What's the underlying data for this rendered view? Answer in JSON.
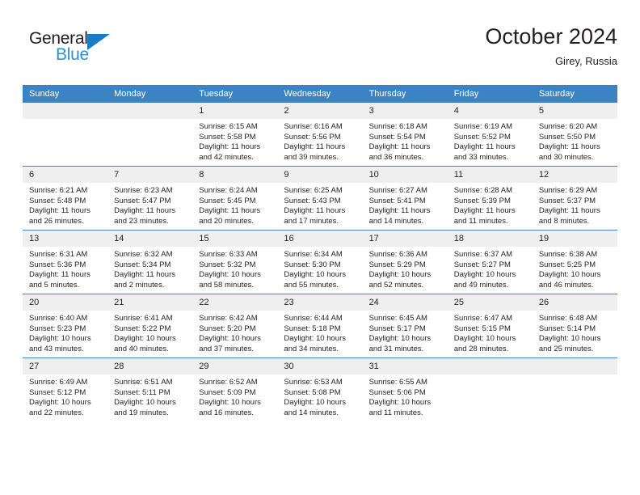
{
  "brand": {
    "name_top": "General",
    "name_bottom": "Blue",
    "triangle_color": "#1b7bc4",
    "blue_text_color": "#2f8fd6"
  },
  "header": {
    "title": "October 2024",
    "subtitle": "Girey, Russia"
  },
  "theme": {
    "header_bg": "#3c83c4",
    "header_text": "#ffffff",
    "daynum_bg": "#efefef",
    "row_divider": "#3c83c4",
    "body_text": "#231f20"
  },
  "weekdays": [
    "Sunday",
    "Monday",
    "Tuesday",
    "Wednesday",
    "Thursday",
    "Friday",
    "Saturday"
  ],
  "labels": {
    "sunrise_prefix": "Sunrise:",
    "sunset_prefix": "Sunset:",
    "daylight_prefix": "Daylight:"
  },
  "weeks": [
    [
      {
        "day": "",
        "empty": true,
        "line1": "",
        "line2": "",
        "line3": "",
        "line4": ""
      },
      {
        "day": "",
        "empty": true,
        "line1": "",
        "line2": "",
        "line3": "",
        "line4": ""
      },
      {
        "day": "1",
        "empty": false,
        "line1": "Sunrise: 6:15 AM",
        "line2": "Sunset: 5:58 PM",
        "line3": "Daylight: 11 hours",
        "line4": "and 42 minutes."
      },
      {
        "day": "2",
        "empty": false,
        "line1": "Sunrise: 6:16 AM",
        "line2": "Sunset: 5:56 PM",
        "line3": "Daylight: 11 hours",
        "line4": "and 39 minutes."
      },
      {
        "day": "3",
        "empty": false,
        "line1": "Sunrise: 6:18 AM",
        "line2": "Sunset: 5:54 PM",
        "line3": "Daylight: 11 hours",
        "line4": "and 36 minutes."
      },
      {
        "day": "4",
        "empty": false,
        "line1": "Sunrise: 6:19 AM",
        "line2": "Sunset: 5:52 PM",
        "line3": "Daylight: 11 hours",
        "line4": "and 33 minutes."
      },
      {
        "day": "5",
        "empty": false,
        "line1": "Sunrise: 6:20 AM",
        "line2": "Sunset: 5:50 PM",
        "line3": "Daylight: 11 hours",
        "line4": "and 30 minutes."
      }
    ],
    [
      {
        "day": "6",
        "empty": false,
        "line1": "Sunrise: 6:21 AM",
        "line2": "Sunset: 5:48 PM",
        "line3": "Daylight: 11 hours",
        "line4": "and 26 minutes."
      },
      {
        "day": "7",
        "empty": false,
        "line1": "Sunrise: 6:23 AM",
        "line2": "Sunset: 5:47 PM",
        "line3": "Daylight: 11 hours",
        "line4": "and 23 minutes."
      },
      {
        "day": "8",
        "empty": false,
        "line1": "Sunrise: 6:24 AM",
        "line2": "Sunset: 5:45 PM",
        "line3": "Daylight: 11 hours",
        "line4": "and 20 minutes."
      },
      {
        "day": "9",
        "empty": false,
        "line1": "Sunrise: 6:25 AM",
        "line2": "Sunset: 5:43 PM",
        "line3": "Daylight: 11 hours",
        "line4": "and 17 minutes."
      },
      {
        "day": "10",
        "empty": false,
        "line1": "Sunrise: 6:27 AM",
        "line2": "Sunset: 5:41 PM",
        "line3": "Daylight: 11 hours",
        "line4": "and 14 minutes."
      },
      {
        "day": "11",
        "empty": false,
        "line1": "Sunrise: 6:28 AM",
        "line2": "Sunset: 5:39 PM",
        "line3": "Daylight: 11 hours",
        "line4": "and 11 minutes."
      },
      {
        "day": "12",
        "empty": false,
        "line1": "Sunrise: 6:29 AM",
        "line2": "Sunset: 5:37 PM",
        "line3": "Daylight: 11 hours",
        "line4": "and 8 minutes."
      }
    ],
    [
      {
        "day": "13",
        "empty": false,
        "line1": "Sunrise: 6:31 AM",
        "line2": "Sunset: 5:36 PM",
        "line3": "Daylight: 11 hours",
        "line4": "and 5 minutes."
      },
      {
        "day": "14",
        "empty": false,
        "line1": "Sunrise: 6:32 AM",
        "line2": "Sunset: 5:34 PM",
        "line3": "Daylight: 11 hours",
        "line4": "and 2 minutes."
      },
      {
        "day": "15",
        "empty": false,
        "line1": "Sunrise: 6:33 AM",
        "line2": "Sunset: 5:32 PM",
        "line3": "Daylight: 10 hours",
        "line4": "and 58 minutes."
      },
      {
        "day": "16",
        "empty": false,
        "line1": "Sunrise: 6:34 AM",
        "line2": "Sunset: 5:30 PM",
        "line3": "Daylight: 10 hours",
        "line4": "and 55 minutes."
      },
      {
        "day": "17",
        "empty": false,
        "line1": "Sunrise: 6:36 AM",
        "line2": "Sunset: 5:29 PM",
        "line3": "Daylight: 10 hours",
        "line4": "and 52 minutes."
      },
      {
        "day": "18",
        "empty": false,
        "line1": "Sunrise: 6:37 AM",
        "line2": "Sunset: 5:27 PM",
        "line3": "Daylight: 10 hours",
        "line4": "and 49 minutes."
      },
      {
        "day": "19",
        "empty": false,
        "line1": "Sunrise: 6:38 AM",
        "line2": "Sunset: 5:25 PM",
        "line3": "Daylight: 10 hours",
        "line4": "and 46 minutes."
      }
    ],
    [
      {
        "day": "20",
        "empty": false,
        "line1": "Sunrise: 6:40 AM",
        "line2": "Sunset: 5:23 PM",
        "line3": "Daylight: 10 hours",
        "line4": "and 43 minutes."
      },
      {
        "day": "21",
        "empty": false,
        "line1": "Sunrise: 6:41 AM",
        "line2": "Sunset: 5:22 PM",
        "line3": "Daylight: 10 hours",
        "line4": "and 40 minutes."
      },
      {
        "day": "22",
        "empty": false,
        "line1": "Sunrise: 6:42 AM",
        "line2": "Sunset: 5:20 PM",
        "line3": "Daylight: 10 hours",
        "line4": "and 37 minutes."
      },
      {
        "day": "23",
        "empty": false,
        "line1": "Sunrise: 6:44 AM",
        "line2": "Sunset: 5:18 PM",
        "line3": "Daylight: 10 hours",
        "line4": "and 34 minutes."
      },
      {
        "day": "24",
        "empty": false,
        "line1": "Sunrise: 6:45 AM",
        "line2": "Sunset: 5:17 PM",
        "line3": "Daylight: 10 hours",
        "line4": "and 31 minutes."
      },
      {
        "day": "25",
        "empty": false,
        "line1": "Sunrise: 6:47 AM",
        "line2": "Sunset: 5:15 PM",
        "line3": "Daylight: 10 hours",
        "line4": "and 28 minutes."
      },
      {
        "day": "26",
        "empty": false,
        "line1": "Sunrise: 6:48 AM",
        "line2": "Sunset: 5:14 PM",
        "line3": "Daylight: 10 hours",
        "line4": "and 25 minutes."
      }
    ],
    [
      {
        "day": "27",
        "empty": false,
        "line1": "Sunrise: 6:49 AM",
        "line2": "Sunset: 5:12 PM",
        "line3": "Daylight: 10 hours",
        "line4": "and 22 minutes."
      },
      {
        "day": "28",
        "empty": false,
        "line1": "Sunrise: 6:51 AM",
        "line2": "Sunset: 5:11 PM",
        "line3": "Daylight: 10 hours",
        "line4": "and 19 minutes."
      },
      {
        "day": "29",
        "empty": false,
        "line1": "Sunrise: 6:52 AM",
        "line2": "Sunset: 5:09 PM",
        "line3": "Daylight: 10 hours",
        "line4": "and 16 minutes."
      },
      {
        "day": "30",
        "empty": false,
        "line1": "Sunrise: 6:53 AM",
        "line2": "Sunset: 5:08 PM",
        "line3": "Daylight: 10 hours",
        "line4": "and 14 minutes."
      },
      {
        "day": "31",
        "empty": false,
        "line1": "Sunrise: 6:55 AM",
        "line2": "Sunset: 5:06 PM",
        "line3": "Daylight: 10 hours",
        "line4": "and 11 minutes."
      },
      {
        "day": "",
        "empty": true,
        "line1": "",
        "line2": "",
        "line3": "",
        "line4": ""
      },
      {
        "day": "",
        "empty": true,
        "line1": "",
        "line2": "",
        "line3": "",
        "line4": ""
      }
    ]
  ]
}
